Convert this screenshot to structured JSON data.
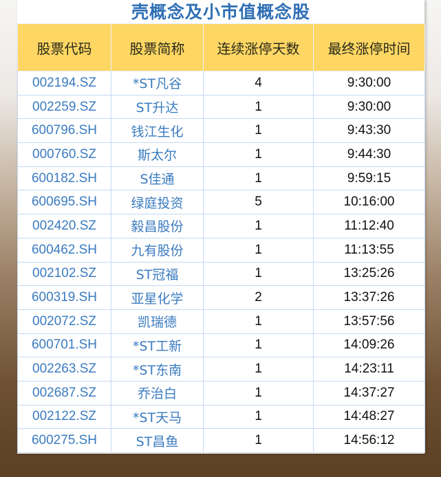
{
  "title": "壳概念及小市值概念股",
  "headers": [
    "股票代码",
    "股票简称",
    "连续涨停天数",
    "最终涨停时间"
  ],
  "rows": [
    [
      "002194.SZ",
      "*ST凡谷",
      "4",
      "9:30:00"
    ],
    [
      "002259.SZ",
      "ST升达",
      "1",
      "9:30:00"
    ],
    [
      "600796.SH",
      "钱江生化",
      "1",
      "9:43:30"
    ],
    [
      "000760.SZ",
      "斯太尔",
      "1",
      "9:44:30"
    ],
    [
      "600182.SH",
      "S佳通",
      "1",
      "9:59:15"
    ],
    [
      "600695.SH",
      "绿庭投资",
      "5",
      "10:16:00"
    ],
    [
      "002420.SZ",
      "毅昌股份",
      "1",
      "11:12:40"
    ],
    [
      "600462.SH",
      "九有股份",
      "1",
      "11:13:55"
    ],
    [
      "002102.SZ",
      "ST冠福",
      "1",
      "13:25:26"
    ],
    [
      "600319.SH",
      "亚星化学",
      "2",
      "13:37:26"
    ],
    [
      "002072.SZ",
      "凯瑞德",
      "1",
      "13:57:56"
    ],
    [
      "600701.SH",
      "*ST工新",
      "1",
      "14:09:26"
    ],
    [
      "002263.SZ",
      "*ST东南",
      "1",
      "14:23:11"
    ],
    [
      "002687.SZ",
      "乔治白",
      "1",
      "14:37:27"
    ],
    [
      "002122.SZ",
      "*ST天马",
      "1",
      "14:48:27"
    ],
    [
      "600275.SH",
      "ST昌鱼",
      "1",
      "14:56:12"
    ]
  ]
}
